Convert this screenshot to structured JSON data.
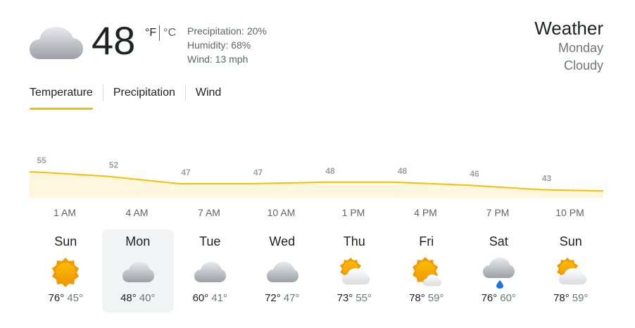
{
  "current": {
    "icon": "cloudy-icon",
    "temperature": "48",
    "unit_f": "°F",
    "unit_c": "°C",
    "precipitation": "Precipitation: 20%",
    "humidity": "Humidity: 68%",
    "wind": "Wind: 13 mph"
  },
  "header": {
    "title": "Weather",
    "day": "Monday",
    "condition": "Cloudy"
  },
  "tabs": [
    {
      "label": "Temperature",
      "active": true
    },
    {
      "label": "Precipitation",
      "active": false
    },
    {
      "label": "Wind",
      "active": false
    }
  ],
  "chart_data": {
    "type": "area",
    "x": [
      "1 AM",
      "4 AM",
      "7 AM",
      "10 AM",
      "1 PM",
      "4 PM",
      "7 PM",
      "10 PM"
    ],
    "labels": [
      55,
      52,
      47,
      47,
      48,
      48,
      46,
      43
    ],
    "colors": {
      "line": "#fbbc04",
      "fill": "#fef7e0",
      "label": "#9aa0a6"
    }
  },
  "forecast": [
    {
      "day": "Sun",
      "icon": "sunny-icon",
      "high": "76°",
      "low": "45°",
      "selected": false
    },
    {
      "day": "Mon",
      "icon": "cloudy-icon",
      "high": "48°",
      "low": "40°",
      "selected": true
    },
    {
      "day": "Tue",
      "icon": "cloudy-icon",
      "high": "60°",
      "low": "41°",
      "selected": false
    },
    {
      "day": "Wed",
      "icon": "cloudy-icon",
      "high": "72°",
      "low": "47°",
      "selected": false
    },
    {
      "day": "Thu",
      "icon": "partly-cloudy-icon",
      "high": "73°",
      "low": "55°",
      "selected": false
    },
    {
      "day": "Fri",
      "icon": "mostly-sunny-icon",
      "high": "78°",
      "low": "59°",
      "selected": false
    },
    {
      "day": "Sat",
      "icon": "rain-icon",
      "high": "76°",
      "low": "60°",
      "selected": false
    },
    {
      "day": "Sun",
      "icon": "partly-cloudy-icon",
      "high": "78°",
      "low": "59°",
      "selected": false
    }
  ]
}
